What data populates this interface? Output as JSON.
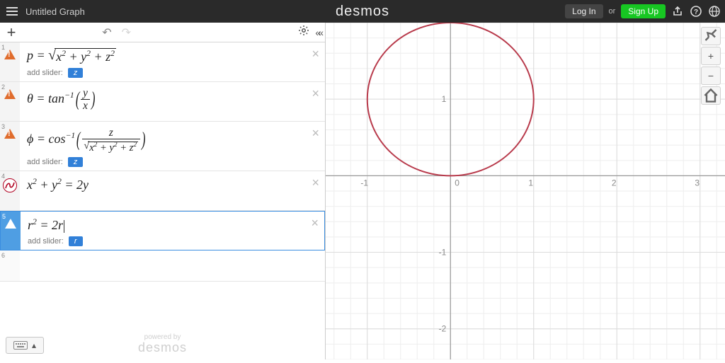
{
  "topbar": {
    "title": "Untitled Graph",
    "brand": "desmos",
    "login": "Log In",
    "or": "or",
    "signup": "Sign Up"
  },
  "toolbar": {
    "add_label": "+"
  },
  "expressions": [
    {
      "num": "1",
      "status": "warn",
      "slider_prompt": "add slider:",
      "slider_var": "z"
    },
    {
      "num": "2",
      "status": "warn"
    },
    {
      "num": "3",
      "status": "warn",
      "slider_prompt": "add slider:",
      "slider_var": "z"
    },
    {
      "num": "4",
      "status": "plot"
    },
    {
      "num": "5",
      "status": "warn-active",
      "slider_prompt": "add slider:",
      "slider_var": "r"
    },
    {
      "num": "6",
      "status": "empty"
    }
  ],
  "footer": {
    "powered": "powered by",
    "brand": "desmos"
  },
  "chart_data": {
    "type": "scatter",
    "title": "",
    "xlabel": "",
    "ylabel": "",
    "xlim": [
      -1.5,
      3.3
    ],
    "ylim": [
      -2.4,
      2.0
    ],
    "x_ticks": [
      -1,
      0,
      1,
      2,
      3
    ],
    "y_ticks": [
      -2,
      -1,
      1
    ],
    "curves": [
      {
        "name": "x^2 + y^2 = 2y",
        "kind": "circle",
        "cx": 0,
        "cy": 1,
        "r": 1
      }
    ]
  },
  "side_tools": {
    "wrench": "wrench-icon",
    "zoom_in": "+",
    "zoom_out": "−",
    "home": "home-icon"
  }
}
